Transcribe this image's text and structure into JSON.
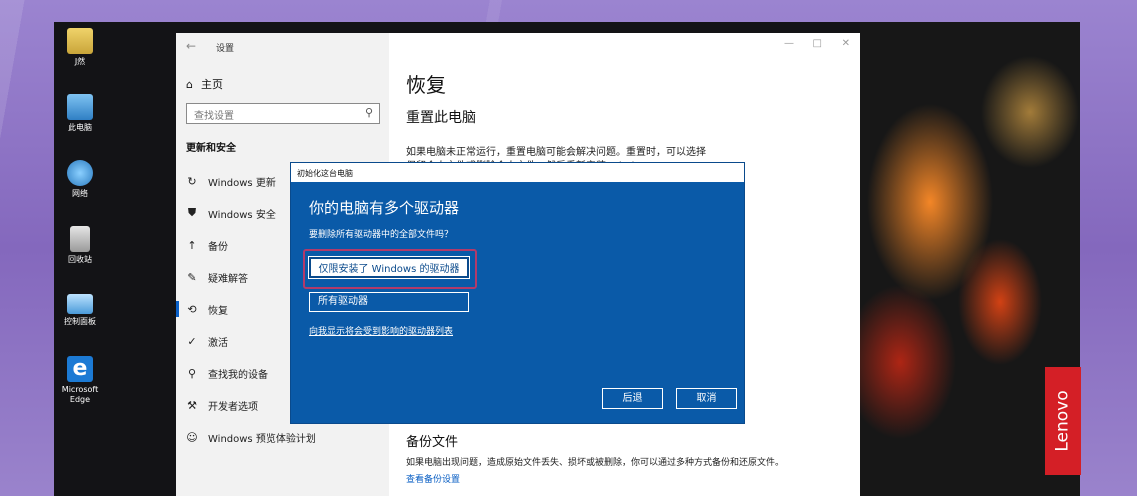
{
  "desktop": {
    "icons": [
      {
        "label": "J然",
        "icon": "user-folder-icon"
      },
      {
        "label": "此电脑",
        "icon": "computer-icon"
      },
      {
        "label": "网络",
        "icon": "network-icon"
      },
      {
        "label": "回收站",
        "icon": "recycle-bin-icon"
      },
      {
        "label": "控制面板",
        "icon": "control-panel-icon"
      },
      {
        "label": "Microsoft Edge",
        "icon": "edge-icon"
      }
    ]
  },
  "settings": {
    "title": "设置",
    "back_glyph": "←",
    "home_label": "主页",
    "search_placeholder": "查找设置",
    "section_label": "更新和安全",
    "nav_items": [
      {
        "label": "Windows 更新",
        "icon": "refresh-icon",
        "glyph": "↻"
      },
      {
        "label": "Windows 安全",
        "icon": "shield-icon",
        "glyph": "⛊"
      },
      {
        "label": "备份",
        "icon": "upload-icon",
        "glyph": "↑"
      },
      {
        "label": "疑难解答",
        "icon": "wrench-icon",
        "glyph": "✎"
      },
      {
        "label": "恢复",
        "icon": "recovery-icon",
        "glyph": "⟲"
      },
      {
        "label": "激活",
        "icon": "check-circle-icon",
        "glyph": "✓"
      },
      {
        "label": "查找我的设备",
        "icon": "person-icon",
        "glyph": "⚲"
      },
      {
        "label": "开发者选项",
        "icon": "tools-icon",
        "glyph": "⚒"
      },
      {
        "label": "Windows 预览体验计划",
        "icon": "smiley-icon",
        "glyph": "☺"
      }
    ],
    "active_index": 4,
    "window_controls": {
      "minimize": "—",
      "maximize": "□",
      "close": "✕"
    },
    "page_title": "恢复",
    "reset_heading": "重置此电脑",
    "reset_desc": "如果电脑未正常运行，重置电脑可能会解决问题。重置时，可以选择保留个人文件或删除个人文件，然后重新安装 Windows。",
    "backup_heading": "备份文件",
    "backup_desc": "如果电脑出现问题，造成原始文件丢失、损坏或被删除，你可以通过多种方式备份和还原文件。",
    "backup_link": "查看备份设置"
  },
  "dialog": {
    "title": "初始化这台电脑",
    "heading": "你的电脑有多个驱动器",
    "question": "要删除所有驱动器中的全部文件吗？",
    "option_windows_only": "仅限安装了 Windows 的驱动器",
    "option_all_drives": "所有驱动器",
    "show_list_link": "向我显示将会受到影响的驱动器列表",
    "back_button": "后退",
    "cancel_button": "取消"
  },
  "brand": {
    "logo_text": "Lenovo",
    "logo_color": "#d41f26"
  },
  "colors": {
    "dialog_bg": "#0a5aa8",
    "highlight_border": "#b23a6a",
    "link": "#0a5fc4"
  }
}
